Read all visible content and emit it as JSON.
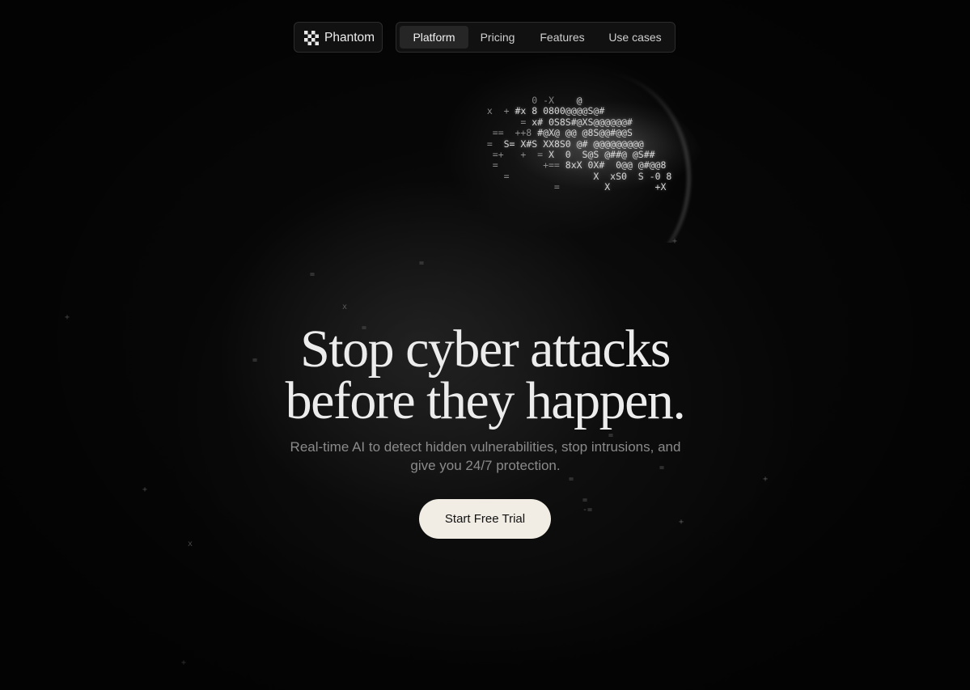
{
  "brand": {
    "name": "Phantom",
    "logo_icon": "checkerboard-logo-icon"
  },
  "nav": {
    "items": [
      {
        "label": "Platform",
        "active": true
      },
      {
        "label": "Pricing",
        "active": false
      },
      {
        "label": "Features",
        "active": false
      },
      {
        "label": "Use cases",
        "active": false
      }
    ]
  },
  "hero": {
    "headline_line1": "Stop cyber attacks",
    "headline_line2": "before they happen.",
    "subtitle": "Real-time AI to detect hidden vulnerabilities, stop intrusions, and give you 24/7 protection.",
    "cta_label": "Start Free Trial"
  },
  "colors": {
    "background": "#060606",
    "cta_background": "#f1ede4",
    "headline": "#ececec",
    "subtitle": "#8a8a8a"
  }
}
